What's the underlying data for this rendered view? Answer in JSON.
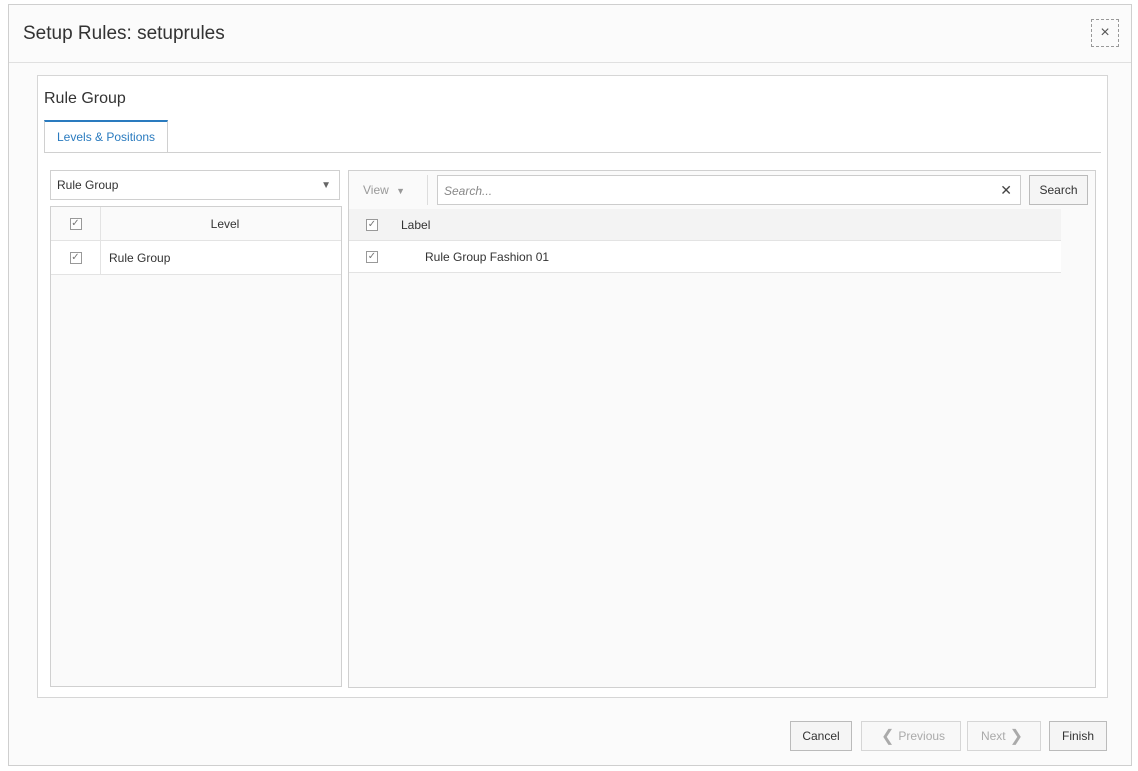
{
  "dialog": {
    "title": "Setup Rules: setuprules",
    "close_icon": "×"
  },
  "section": {
    "title": "Rule Group"
  },
  "tabs": [
    {
      "label": "Levels & Positions"
    }
  ],
  "left_panel": {
    "select_value": "Rule Group",
    "select_arrow": "▼",
    "columns": {
      "level": "Level"
    },
    "rows": [
      {
        "label": "Rule Group",
        "checked": true
      }
    ]
  },
  "right_panel": {
    "view_label": "View",
    "view_arrow": "▼",
    "search": {
      "placeholder": "Search...",
      "value": ""
    },
    "clear_icon": "✕",
    "search_button": "Search",
    "columns": {
      "label": "Label"
    },
    "rows": [
      {
        "label": "Rule Group Fashion 01",
        "checked": true
      }
    ]
  },
  "footer": {
    "cancel": "Cancel",
    "previous": "Previous",
    "next": "Next",
    "finish": "Finish",
    "prev_chevron": "❮",
    "next_chevron": "❯"
  },
  "checkmark": "✓"
}
